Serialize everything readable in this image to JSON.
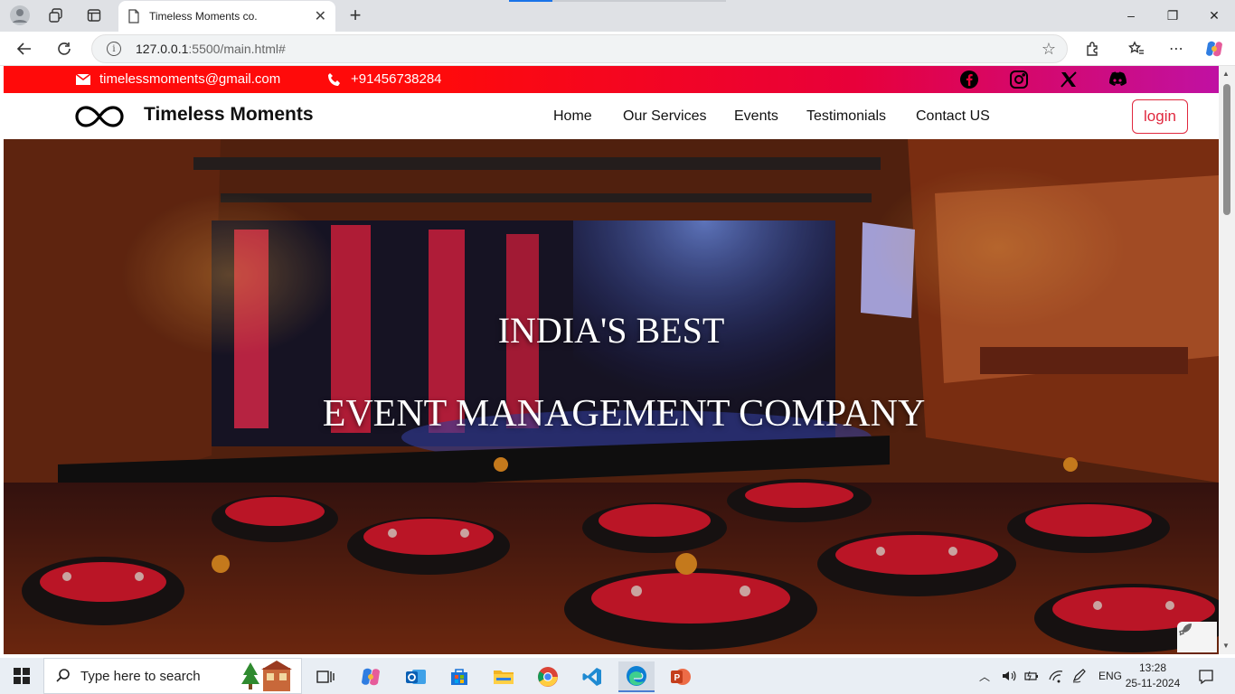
{
  "browser": {
    "tab_title": "Timeless Moments co.",
    "tab_close": "✕",
    "new_tab": "+",
    "url_host": "127.0.0.1",
    "url_path": ":5500/main.html#",
    "window_controls": {
      "minimize": "–",
      "restore": "❐",
      "close": "✕"
    }
  },
  "site": {
    "email": "timelessmoments@gmail.com",
    "phone": "+91456738284",
    "brand": "Timeless Moments",
    "nav": [
      "Home",
      "Our Services",
      "Events",
      "Testimonials",
      "Contact US"
    ],
    "login_label": "login",
    "hero_line1": "INDIA'S BEST",
    "hero_line2": "EVENT MANAGEMENT COMPANY",
    "social_icons": [
      "facebook-icon",
      "instagram-icon",
      "x-icon",
      "discord-icon"
    ]
  },
  "taskbar": {
    "search_placeholder": "Type here to search",
    "language": "ENG",
    "time": "13:28",
    "date": "25-11-2024"
  },
  "colors": {
    "strip_start": "#ff0a0a",
    "strip_end": "#c011a3",
    "login_accent": "#e0283e"
  }
}
